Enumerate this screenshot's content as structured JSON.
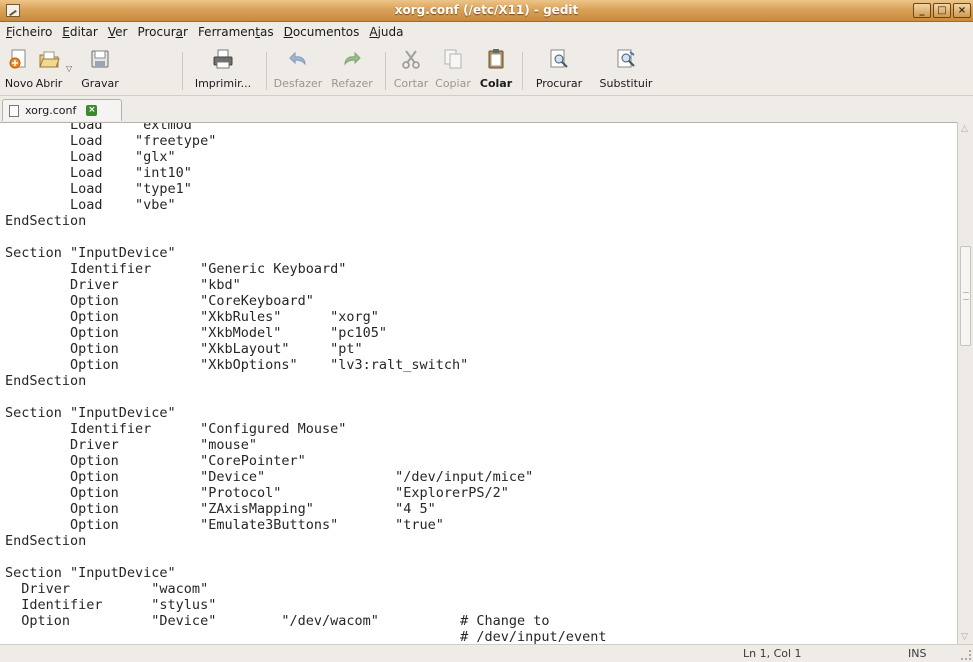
{
  "window": {
    "title": "xorg.conf (/etc/X11) - gedit",
    "controls": {
      "minimize": "_",
      "maximize": "□",
      "close": "×"
    }
  },
  "menubar": [
    {
      "label": "Ficheiro",
      "mnemonic": "F"
    },
    {
      "label": "Editar",
      "mnemonic": "E"
    },
    {
      "label": "Ver",
      "mnemonic": "V"
    },
    {
      "label": "Procurar",
      "mnemonic": "a"
    },
    {
      "label": "Ferramentas",
      "mnemonic": "t"
    },
    {
      "label": "Documentos",
      "mnemonic": "D"
    },
    {
      "label": "Ajuda",
      "mnemonic": "A"
    }
  ],
  "toolbar": {
    "new": "Novo",
    "open": "Abrir",
    "save": "Gravar",
    "print": "Imprimir...",
    "undo": "Desfazer",
    "redo": "Refazer",
    "cut": "Cortar",
    "copy": "Copiar",
    "paste": "Colar",
    "find": "Procurar",
    "replace": "Substituir"
  },
  "tab": {
    "label": "xorg.conf"
  },
  "editor": {
    "lines": [
      "        Load    \"extmod\"",
      "        Load    \"freetype\"",
      "        Load    \"glx\"",
      "        Load    \"int10\"",
      "        Load    \"type1\"",
      "        Load    \"vbe\"",
      "EndSection",
      "",
      "Section \"InputDevice\"",
      "        Identifier      \"Generic Keyboard\"",
      "        Driver          \"kbd\"",
      "        Option          \"CoreKeyboard\"",
      "        Option          \"XkbRules\"      \"xorg\"",
      "        Option          \"XkbModel\"      \"pc105\"",
      "        Option          \"XkbLayout\"     \"pt\"",
      "        Option          \"XkbOptions\"    \"lv3:ralt_switch\"",
      "EndSection",
      "",
      "Section \"InputDevice\"",
      "        Identifier      \"Configured Mouse\"",
      "        Driver          \"mouse\"",
      "        Option          \"CorePointer\"",
      "        Option          \"Device\"                \"/dev/input/mice\"",
      "        Option          \"Protocol\"              \"ExplorerPS/2\"",
      "        Option          \"ZAxisMapping\"          \"4 5\"",
      "        Option          \"Emulate3Buttons\"       \"true\"",
      "EndSection",
      "",
      "Section \"InputDevice\"",
      "  Driver          \"wacom\"",
      "  Identifier      \"stylus\"",
      "  Option          \"Device\"        \"/dev/wacom\"          # Change to",
      "                                                        # /dev/input/event"
    ]
  },
  "statusbar": {
    "position": "Ln 1, Col 1",
    "mode": "INS"
  },
  "icons": {
    "new": "new-document-icon",
    "open": "open-folder-icon",
    "save": "save-floppy-icon",
    "print": "printer-icon",
    "undo": "undo-arrow-icon",
    "redo": "redo-arrow-icon",
    "cut": "scissors-icon",
    "copy": "copy-icon",
    "paste": "clipboard-icon",
    "find": "magnifier-icon",
    "replace": "replace-icon"
  },
  "colors": {
    "titlebar": "#d9a25a",
    "window_bg": "#efebe7",
    "editor_bg": "#ffffff"
  }
}
